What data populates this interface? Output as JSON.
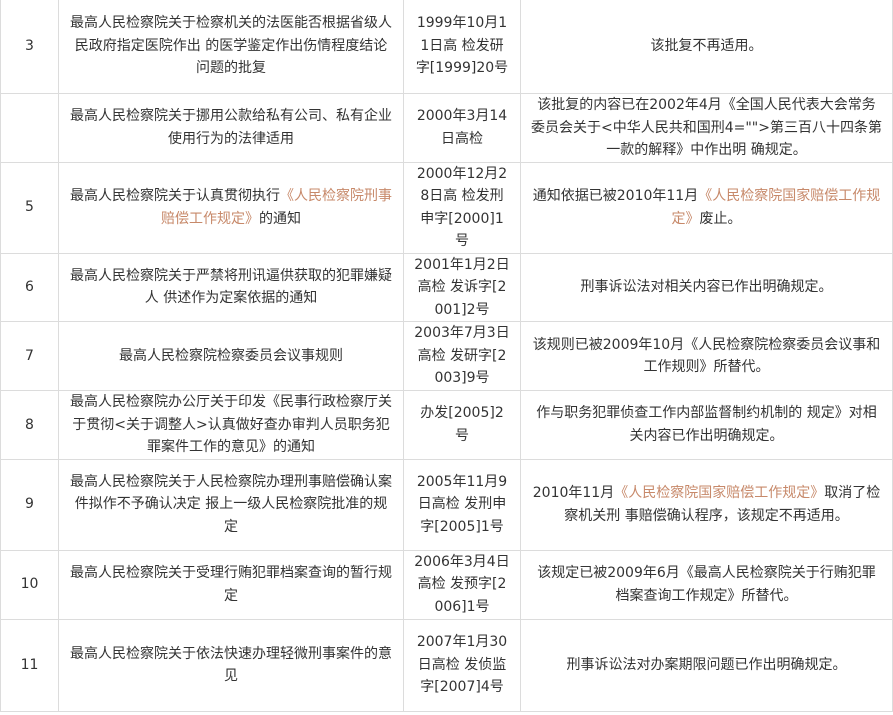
{
  "rows": [
    {
      "num": "3",
      "title": "最高人民检察院关于检察机关的法医能否根据省级人民政府指定医院作出 的医学鉴定作出伤情程度结论问题的批复",
      "doc_no": "1999年10月11日高 检发研字[1999]20号",
      "note": [
        {
          "text": "该批复不再适用。"
        }
      ]
    },
    {
      "num": "",
      "title": "最高人民检察院关于挪用公款给私有公司、私有企业使用行为的法律适用",
      "doc_no": "2000年3月14日高检",
      "note": [
        {
          "text": "该批复的内容已在2002年4月《全国人民代表大会常务委员会关于<中华人民共和国刑4=\"\">第三百八十四条第一款的解释》中作出明 确规定。"
        }
      ]
    },
    {
      "num": "5",
      "title": [
        {
          "text": "最高人民检察院关于认真贯彻执行"
        },
        {
          "text": "《人民检察院刑事赔偿工作规定》",
          "link": true
        },
        {
          "text": "的通知"
        }
      ],
      "doc_no": "2000年12月28日高 检发刑申字[2000]1号",
      "note": [
        {
          "text": "通知依据已被2010年11月"
        },
        {
          "text": "《人民检察院国家赔偿工作规定》",
          "link": true
        },
        {
          "text": "废止。"
        }
      ]
    },
    {
      "num": "6",
      "title": "最高人民检察院关于严禁将刑讯逼供获取的犯罪嫌疑人 供述作为定案依据的通知",
      "doc_no": "2001年1月2日高检 发诉字[2001]2号",
      "note": [
        {
          "text": "刑事诉讼法对相关内容已作出明确规定。"
        }
      ]
    },
    {
      "num": "7",
      "title": "最高人民检察院检察委员会议事规则",
      "doc_no": "2003年7月3日高检 发研字[2003]9号",
      "note": [
        {
          "text": "该规则已被2009年10月《人民检察院检察委员会议事和工作规则》所替代。"
        }
      ]
    },
    {
      "num": "8",
      "title": "最高人民检察院办公厅关于印发《民事行政检察厅关于贯彻<关于调整人>认真做好查办审判人员职务犯罪案件工作的意见》的通知",
      "doc_no": "办发[2005]2号",
      "note": [
        {
          "text": "作与职务犯罪侦查工作内部监督制约机制的 规定》对相关内容已作出明确规定。"
        }
      ]
    },
    {
      "num": "9",
      "title": "最高人民检察院关于人民检察院办理刑事赔偿确认案件拟作不予确认决定 报上一级人民检察院批准的规定",
      "doc_no": "2005年11月9日高检 发刑申字[2005]1号",
      "note": [
        {
          "text": "2010年11月"
        },
        {
          "text": "《人民检察院国家赔偿工作规定》",
          "link": true
        },
        {
          "text": "取消了检察机关刑 事赔偿确认程序，该规定不再适用。"
        }
      ]
    },
    {
      "num": "10",
      "title": "最高人民检察院关于受理行贿犯罪档案查询的暂行规定",
      "doc_no": "2006年3月4日高检 发预字[2006]1号",
      "note": [
        {
          "text": "该规定已被2009年6月《最高人民检察院关于行贿犯罪档案查询工作规定》所替代。"
        }
      ]
    },
    {
      "num": "11",
      "title": "最高人民检察院关于依法快速办理轻微刑事案件的意见",
      "doc_no": "2007年1月30日高检 发侦监字[2007]4号",
      "note": [
        {
          "text": "刑事诉讼法对办案期限问题已作出明确规定。"
        }
      ]
    }
  ]
}
